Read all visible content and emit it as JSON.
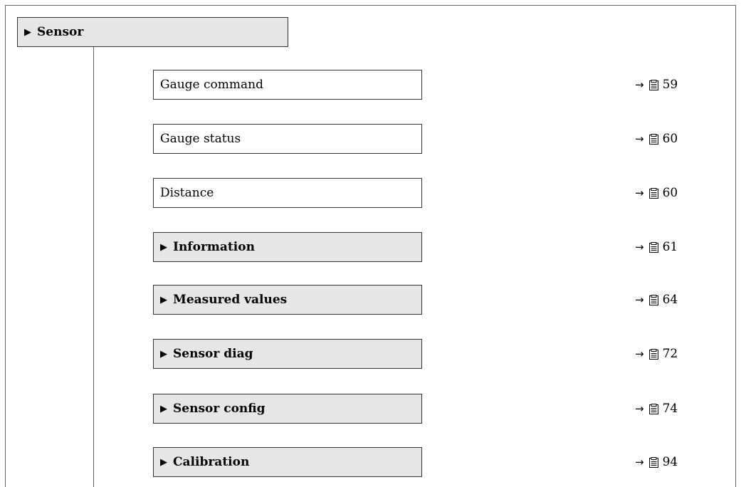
{
  "header": {
    "label": "Sensor",
    "icon": "triangle-right-icon"
  },
  "items": [
    {
      "label": "Gauge command",
      "kind": "parameter",
      "page": "59"
    },
    {
      "label": "Gauge status",
      "kind": "parameter",
      "page": "60"
    },
    {
      "label": "Distance",
      "kind": "parameter",
      "page": "60"
    },
    {
      "label": "Information",
      "kind": "submenu",
      "page": "61"
    },
    {
      "label": "Measured values",
      "kind": "submenu",
      "page": "64"
    },
    {
      "label": "Sensor diag",
      "kind": "submenu",
      "page": "72"
    },
    {
      "label": "Sensor config",
      "kind": "submenu",
      "page": "74"
    },
    {
      "label": "Calibration",
      "kind": "submenu",
      "page": "94"
    }
  ],
  "ref_arrow": "→",
  "submenu_marker": "▶",
  "colors": {
    "menu_fill": "#e6e6e6",
    "border": "#333333"
  }
}
